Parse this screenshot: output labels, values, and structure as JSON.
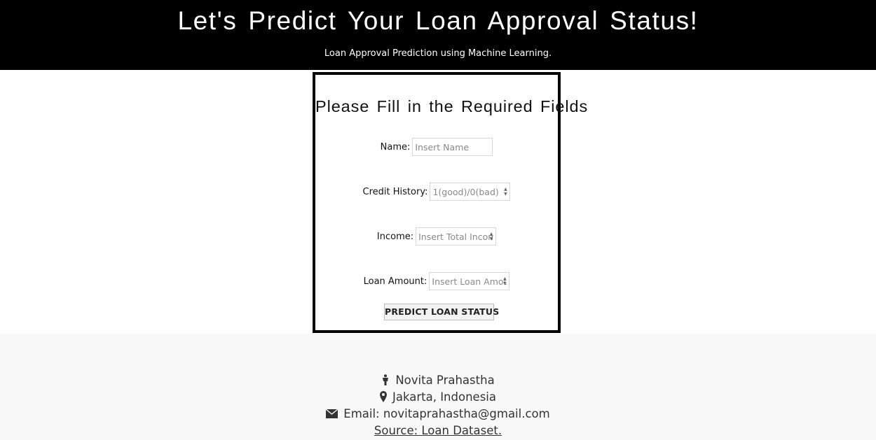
{
  "header": {
    "title": "Let's Predict Your Loan Approval Status!",
    "subtitle": "Loan Approval Prediction using Machine Learning."
  },
  "form": {
    "title": "Please Fill in the Required Fields",
    "fields": [
      {
        "label": "Name:",
        "placeholder": "Insert Name"
      },
      {
        "label": "Credit History:",
        "placeholder": "1(good)/0(bad)"
      },
      {
        "label": "Income:",
        "placeholder": "Insert Total Income"
      },
      {
        "label": "Loan Amount:",
        "placeholder": "Insert Loan Amount"
      }
    ],
    "submit_label": "PREDICT LOAN STATUS"
  },
  "footer": {
    "name": "Novita Prahastha",
    "location": "Jakarta, Indonesia",
    "email": "Email: novitaprahastha@gmail.com",
    "source": "Source: Loan Dataset.",
    "icons": [
      "person-icon",
      "map-marker-icon",
      "envelope-icon"
    ]
  },
  "colors": {
    "header_bg": "#000000",
    "header_text": "#ffffff",
    "footer_bg": "#f8f8f8",
    "text": "#333333"
  }
}
